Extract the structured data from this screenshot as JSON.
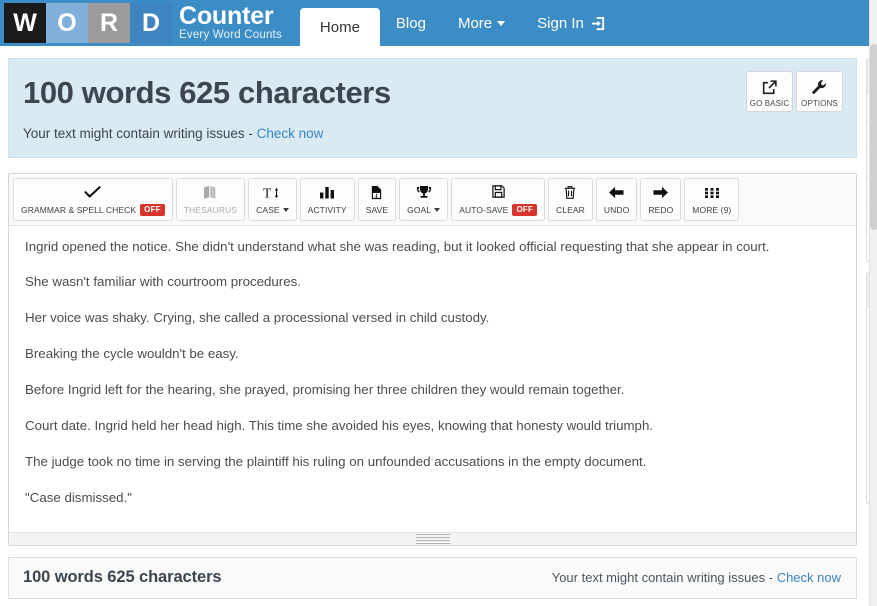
{
  "navbar": {
    "logo": {
      "tiles": [
        {
          "letter": "W",
          "color": "#1b1b1b"
        },
        {
          "letter": "O",
          "color": "#81b0db"
        },
        {
          "letter": "R",
          "color": "#9b9b9b"
        },
        {
          "letter": "D",
          "color": "#3e84c0"
        }
      ],
      "wordmark": "Counter",
      "tagline": "Every Word Counts"
    },
    "items": [
      {
        "label": "Home",
        "active": true,
        "icon": null
      },
      {
        "label": "Blog",
        "active": false,
        "icon": null
      },
      {
        "label": "More",
        "active": false,
        "icon": "chevron-down-icon"
      },
      {
        "label": "Sign In",
        "active": false,
        "icon": "sign-in-icon"
      }
    ],
    "background": "#3c8dc5"
  },
  "info_panel": {
    "count_title": "100 words 625 characters",
    "issues_text": "Your text might contain writing issues - ",
    "issues_link": "Check now",
    "background": "#d9eaf3",
    "link_color": "#3a84c3",
    "actions": [
      {
        "label": "GO BASIC",
        "icon": "external-link-icon"
      },
      {
        "label": "OPTIONS",
        "icon": "wrench-icon"
      }
    ]
  },
  "toolbar": {
    "buttons": [
      {
        "label": "GRAMMAR & SPELL CHECK",
        "icon": "check-icon",
        "badge": "OFF",
        "caret": false,
        "disabled": false
      },
      {
        "label": "THESAURUS",
        "icon": "book-icon",
        "badge": null,
        "caret": false,
        "disabled": true
      },
      {
        "label": "CASE",
        "icon": "text-case-icon",
        "badge": null,
        "caret": true,
        "disabled": false
      },
      {
        "label": "ACTIVITY",
        "icon": "bar-chart-icon",
        "badge": null,
        "caret": false,
        "disabled": false
      },
      {
        "label": "SAVE",
        "icon": "save-document-icon",
        "badge": null,
        "caret": false,
        "disabled": false
      },
      {
        "label": "GOAL",
        "icon": "trophy-icon",
        "badge": null,
        "caret": true,
        "disabled": false
      },
      {
        "label": "AUTO-SAVE",
        "icon": "floppy-disk-icon",
        "badge": "OFF",
        "caret": false,
        "disabled": false
      },
      {
        "label": "CLEAR",
        "icon": "trash-icon",
        "badge": null,
        "caret": false,
        "disabled": false
      },
      {
        "label": "UNDO",
        "icon": "arrow-left-icon",
        "badge": null,
        "caret": false,
        "disabled": false
      },
      {
        "label": "REDO",
        "icon": "arrow-right-icon",
        "badge": null,
        "caret": false,
        "disabled": false
      },
      {
        "label": "MORE (9)",
        "icon": "grid-icon",
        "badge": null,
        "caret": false,
        "disabled": false
      }
    ],
    "badge_color": "#d9342b"
  },
  "editor": {
    "paragraphs": [
      "Ingrid opened the notice. She didn't understand what she was reading, but it looked official requesting that she appear in court.",
      "She wasn't familiar with courtroom procedures.",
      "Her voice was shaky. Crying, she called a processional versed in child custody.",
      "Breaking the cycle wouldn't be easy.",
      "Before Ingrid left for the hearing, she prayed, promising her three children they would remain together.",
      "Court date. Ingrid held her head high. This time she avoided his eyes, knowing that honesty would triumph.",
      "The judge took no time in serving the plaintiff his ruling on unfounded accusations in the empty document.",
      "\"Case dismissed.\""
    ]
  },
  "status_bar": {
    "count": "100 words 625 characters",
    "issues_text": "Your text might contain writing issues - ",
    "issues_link": "Check now"
  }
}
